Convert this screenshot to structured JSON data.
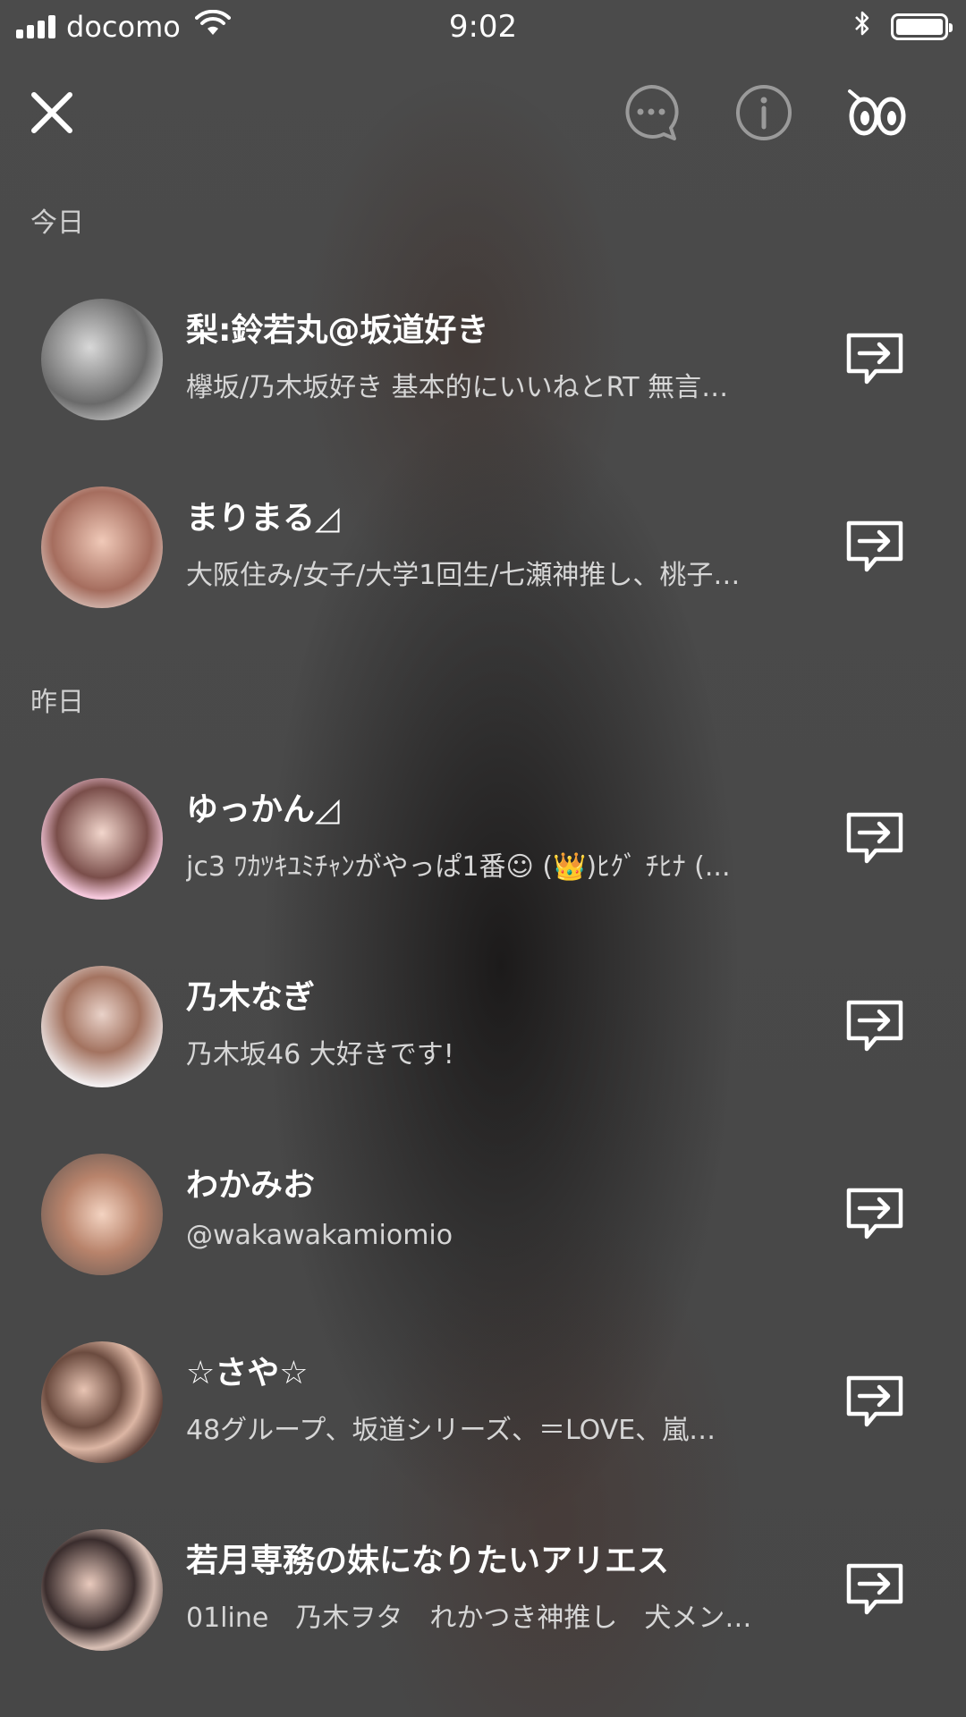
{
  "status_bar": {
    "carrier": "docomo",
    "time": "9:02"
  },
  "toolbar": {
    "close_icon": "close-icon",
    "chat_icon": "chat-bubble-icon",
    "info_icon": "info-icon",
    "footprints_icon": "footprint-eyes-icon"
  },
  "sections": [
    {
      "label": "今日",
      "rows": [
        {
          "name": "梨:鈴若丸@坂道好き",
          "description": "欅坂/乃木坂好き 基本的にいいねとRT 無言…"
        },
        {
          "name": "まりまる◿",
          "description": "大阪住み/女子/大学1回生/七瀬神推し、桃子…"
        }
      ]
    },
    {
      "label": "昨日",
      "rows": [
        {
          "name": "ゆっかん◿",
          "description": "jc3 ﾜｶﾂｷﾕﾐﾁｬﾝがやっぱ1番☺ (👑)ﾋｸﾞ ﾁﾋﾅ (..."
        },
        {
          "name": "乃木なぎ",
          "description": "乃木坂46  大好きです!"
        },
        {
          "name": "わかみお",
          "description": "@wakawakamiomio"
        },
        {
          "name": "☆さや☆",
          "description": "48グループ、坂道シリーズ、＝LOVE、嵐…"
        },
        {
          "name": "若月専務の妹になりたいアリエス",
          "description": "01line　乃木ヲタ　れかつき神推し　犬メン…"
        }
      ]
    }
  ],
  "colors": {
    "background": "#4a4a4a",
    "text_primary": "#ffffff",
    "text_secondary": "#d6d6d6",
    "icon_muted": "#9a9a9a"
  }
}
